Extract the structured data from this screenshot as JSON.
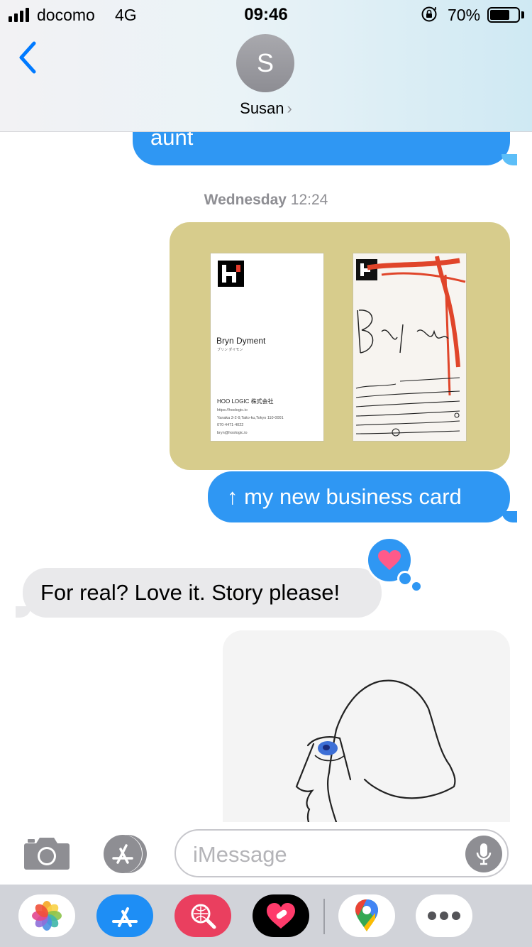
{
  "status_bar": {
    "carrier": "docomo",
    "network": "4G",
    "time": "09:46",
    "battery": "70%",
    "battery_level": 0.7
  },
  "header": {
    "avatar_initial": "S",
    "contact_name": "Susan",
    "chevron": "›"
  },
  "conversation": {
    "partial_message": "aunt",
    "timestamp_day": "Wednesday",
    "timestamp_time": "12:24",
    "business_card": {
      "name": "Bryn Dyment",
      "name_kana": "ブリン ダイモン",
      "company": "HOO LOGIC 株式会社",
      "lines": "https://hoologic.io\nYanaka 3-2-9,Taito-ku,Tokyo 110-0001\n070-4471-4022\nbryn@hoologic.io"
    },
    "sent_caption": "↑ my new business card",
    "received_message": "For real? Love it. Story please!",
    "tapback": "heart-icon"
  },
  "input_bar": {
    "placeholder": "iMessage"
  },
  "app_drawer": {
    "apps": [
      "photos-icon",
      "app-store-icon",
      "image-search-icon",
      "digital-touch-icon",
      "google-maps-icon",
      "more-icon"
    ]
  },
  "colors": {
    "sent_bubble": "#2f97f3",
    "received_bubble": "#e9e9eb",
    "accent": "#007aff"
  }
}
